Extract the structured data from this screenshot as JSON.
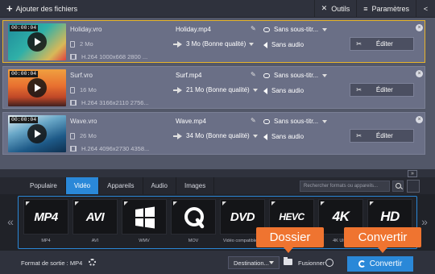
{
  "toolbar": {
    "add_files": "Ajouter des fichiers",
    "tools": "Outils",
    "settings": "Paramètres"
  },
  "files": [
    {
      "duration": "00:00:04",
      "source_name": "Holiday.vro",
      "source_size": "2 Mo",
      "source_codec": "H.264 1000x668 2800 ...",
      "output_name": "Holiday.mp4",
      "output_size": "3 Mo (Bonne qualité)",
      "subtitles": "Sans sous-titr...",
      "audio": "Sans audio",
      "edit_label": "Éditer",
      "selected": true,
      "thumb_colors": [
        "#1f8a9a",
        "#2fb0a8",
        "#d8b858",
        "#e04040"
      ]
    },
    {
      "duration": "00:00:04",
      "source_name": "Surf.vro",
      "source_size": "16 Mo",
      "source_codec": "H.264 3166x2110 2756...",
      "output_name": "Surf.mp4",
      "output_size": "21 Mo (Bonne qualité)",
      "subtitles": "Sans sous-titr...",
      "audio": "Sans audio",
      "edit_label": "Éditer",
      "selected": false,
      "thumb_colors": [
        "#f0a040",
        "#e87030",
        "#c04828",
        "#402020"
      ]
    },
    {
      "duration": "00:00:04",
      "source_name": "Wave.vro",
      "source_size": "26 Mo",
      "source_codec": "H.264 4096x2730 4358...",
      "output_name": "Wave.mp4",
      "output_size": "34 Mo (Bonne qualité)",
      "subtitles": "Sans sous-titr...",
      "audio": "Sans audio",
      "edit_label": "Éditer",
      "selected": false,
      "thumb_colors": [
        "#e8f0f4",
        "#6aa8c8",
        "#1e5a88",
        "#0e3050"
      ]
    }
  ],
  "tabs": [
    "Populaire",
    "Vidéo",
    "Appareils",
    "Audio",
    "Images"
  ],
  "active_tab": "Vidéo",
  "search": {
    "placeholder": "Rechercher formats ou appareils..."
  },
  "formats": [
    {
      "logo": "MP4",
      "label": "MP4",
      "icon": "mp4-logo"
    },
    {
      "logo": "AVI",
      "label": "AVI",
      "icon": "avi-logo"
    },
    {
      "logo": "",
      "label": "WMV",
      "icon": "windows-logo"
    },
    {
      "logo": "",
      "label": "MOV",
      "icon": "quicktime-logo"
    },
    {
      "logo": "DVD",
      "label": "Vidéo compatible ...",
      "icon": "dvd-logo"
    },
    {
      "logo": "HEVC",
      "label": "",
      "icon": "hevc-logo"
    },
    {
      "logo": "4K",
      "label": "4K Ultra",
      "icon": "4k-logo"
    },
    {
      "logo": "HD",
      "label": "",
      "icon": "hd-logo"
    }
  ],
  "bottom": {
    "output_format": "Format de sortie : MP4",
    "destination": "Destination...",
    "merge": "Fusionner",
    "convert": "Convertir"
  },
  "callouts": {
    "folder": "Dossier",
    "convert": "Convertir"
  },
  "colors": {
    "accent": "#2a88d8",
    "selection": "#e7b429",
    "callout": "#ef7430"
  }
}
